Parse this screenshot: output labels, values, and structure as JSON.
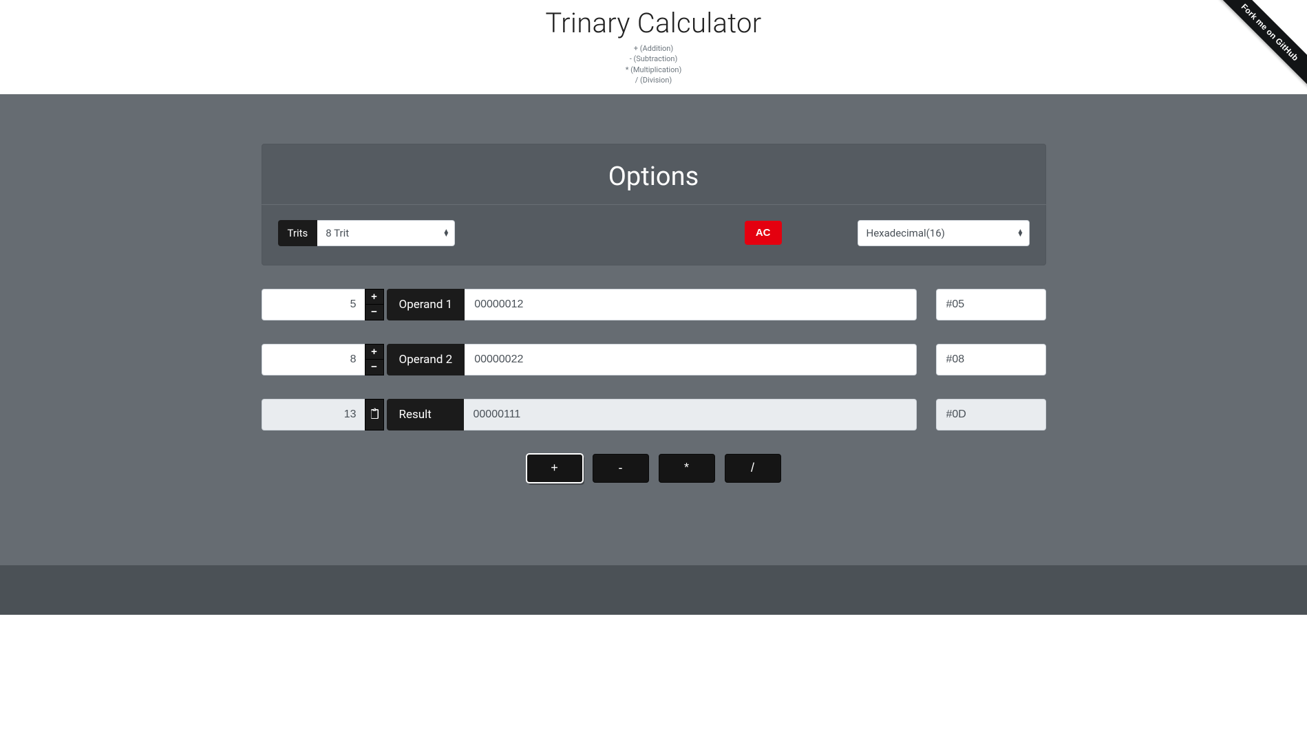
{
  "header": {
    "title": "Trinary Calculator",
    "hints": [
      "+ (Addition)",
      "- (Subtraction)",
      "* (Multiplication)",
      "/ (Division)"
    ]
  },
  "ribbon": {
    "label": "Fork me on GitHub"
  },
  "options": {
    "title": "Options",
    "trits_label": "Trits",
    "trits_value": "8 Trit",
    "ac_label": "AC",
    "base_value": "Hexadecimal(16)"
  },
  "rows": {
    "op1": {
      "dec": "5",
      "plus": "+",
      "minus": "−",
      "label": "Operand 1",
      "tri": "00000012",
      "hex": "#05"
    },
    "op2": {
      "dec": "8",
      "plus": "+",
      "minus": "−",
      "label": "Operand 2",
      "tri": "00000022",
      "hex": "#08"
    },
    "res": {
      "dec": "13",
      "label": "Result",
      "tri": "00000111",
      "hex": "#0D"
    }
  },
  "ops": {
    "add": "+",
    "sub": "-",
    "mul": "*",
    "div": "/"
  }
}
